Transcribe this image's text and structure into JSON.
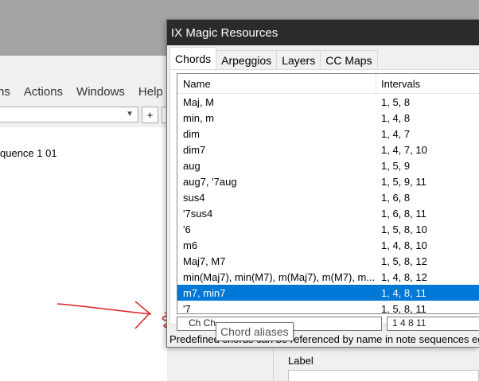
{
  "background_app": {
    "menu": [
      "ns",
      "Actions",
      "Windows",
      "Help"
    ],
    "plus_label": "+",
    "sequence_label": "quence 1 01",
    "panel_label": "Label"
  },
  "dialog": {
    "title": "IX Magic Resources",
    "tabs": [
      "Chords",
      "Arpeggios",
      "Layers",
      "CC Maps"
    ],
    "active_tab": "Chords",
    "columns": {
      "name": "Name",
      "intervals": "Intervals"
    },
    "rows": [
      {
        "name": "Maj, M",
        "intervals": "1, 5, 8"
      },
      {
        "name": "min, m",
        "intervals": "1, 4, 8"
      },
      {
        "name": "dim",
        "intervals": "1, 4, 7"
      },
      {
        "name": "dim7",
        "intervals": "1, 4, 7, 10"
      },
      {
        "name": "aug",
        "intervals": "1, 5, 9"
      },
      {
        "name": "aug7, '7aug",
        "intervals": "1, 5, 9, 11"
      },
      {
        "name": "sus4",
        "intervals": "1, 6, 8"
      },
      {
        "name": "'7sus4",
        "intervals": "1, 6, 8, 11"
      },
      {
        "name": "'6",
        "intervals": "1, 5, 8, 10"
      },
      {
        "name": "m6",
        "intervals": "1, 4, 8, 10"
      },
      {
        "name": "Maj7, M7",
        "intervals": "1, 5, 8, 12"
      },
      {
        "name": "min(Maj7), min(M7), m(Maj7), m(M7), m...",
        "intervals": "1, 4, 8, 12"
      },
      {
        "name": "m7, min7",
        "intervals": "1, 4, 8, 11",
        "selected": true
      },
      {
        "name": "'7",
        "intervals": "1, 5, 8, 11"
      }
    ],
    "filter_value": "Ch Ch...",
    "filter_value2": "1 4 8 11",
    "footer_text": "Predefined chords can be referenced by name in note sequences eg"
  },
  "tooltip": "Chord aliases",
  "colors": {
    "selection": "#0078d7",
    "titlebar": "#2b2b2b",
    "annotation": "#e02020"
  }
}
